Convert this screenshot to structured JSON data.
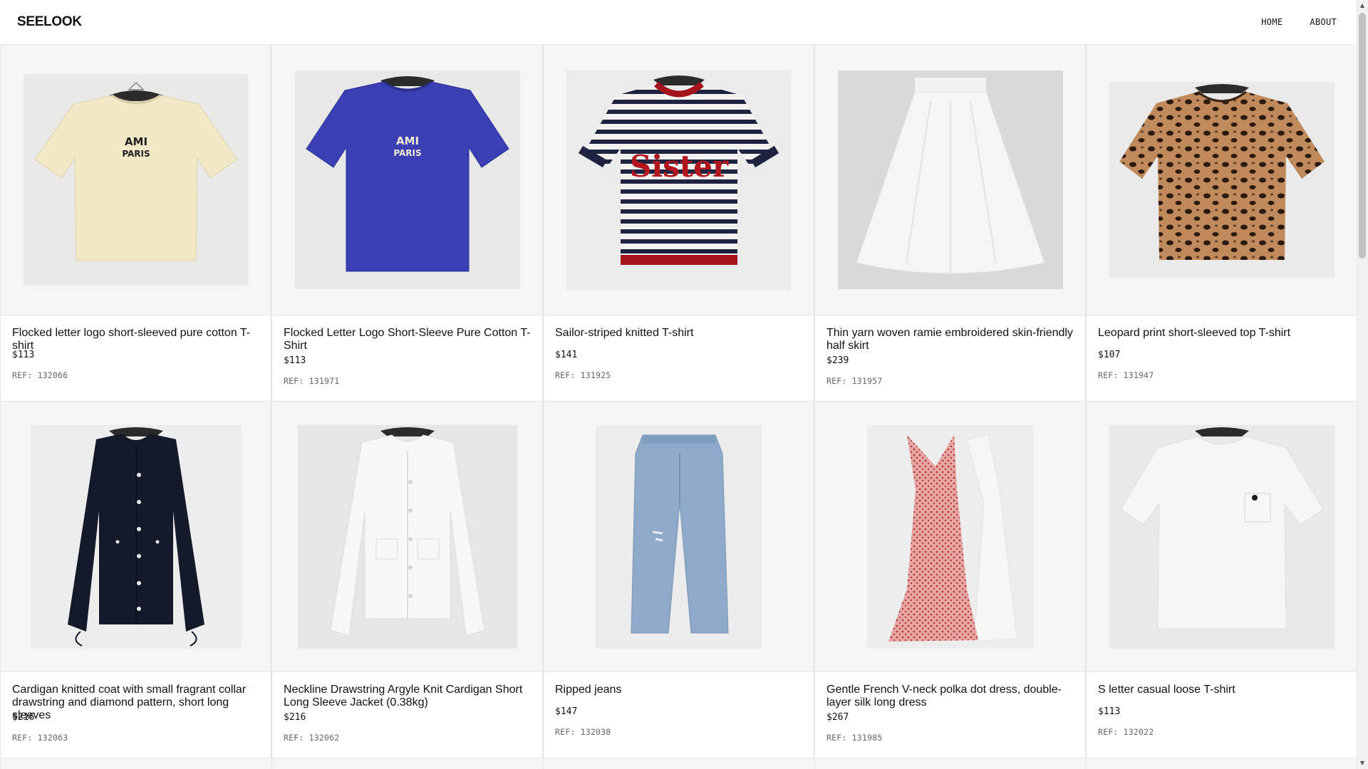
{
  "header": {
    "brand": "SEELOOK",
    "nav": [
      "HOME",
      "ABOUT"
    ]
  },
  "products": [
    {
      "name": "Flocked letter logo short-sleeved pure cotton T-shirt",
      "price": "$113",
      "ref": "REF: 132066",
      "image": "cream-tshirt-ami-paris"
    },
    {
      "name": "Flocked Letter Logo Short-Sleeve Pure Cotton T-Shirt",
      "price": "$113",
      "ref": "REF: 131971",
      "image": "blue-tshirt-ami-paris"
    },
    {
      "name": "Sailor-striped knitted T-shirt",
      "price": "$141",
      "ref": "REF: 131925",
      "image": "striped-knit-tshirt-sister"
    },
    {
      "name": "Thin yarn woven ramie embroidered skin-friendly half skirt",
      "price": "$239",
      "ref": "REF: 131957",
      "image": "white-half-skirt"
    },
    {
      "name": "Leopard print short-sleeved top T-shirt",
      "price": "$107",
      "ref": "REF: 131947",
      "image": "leopard-tshirt"
    },
    {
      "name": "Cardigan knitted coat with small fragrant collar drawstring and diamond pattern, short long sleeves",
      "price": "$216",
      "ref": "REF: 132063",
      "image": "navy-cardigan"
    },
    {
      "name": "Neckline Drawstring Argyle Knit Cardigan Short Long Sleeve Jacket (0.38kg)",
      "price": "$216",
      "ref": "REF: 132062",
      "image": "white-cardigan"
    },
    {
      "name": "Ripped jeans",
      "price": "$147",
      "ref": "REF: 132038",
      "image": "ripped-jeans"
    },
    {
      "name": "Gentle French V-neck polka dot dress, double-layer silk long dress",
      "price": "$267",
      "ref": "REF: 131985",
      "image": "polka-dot-dress"
    },
    {
      "name": "S letter casual loose T-shirt",
      "price": "$113",
      "ref": "REF: 132022",
      "image": "white-loose-tshirt"
    }
  ],
  "print_text": {
    "ami_line1": "AMI",
    "ami_line2": "PARIS",
    "sister": "Sister"
  },
  "colors": {
    "border": "#e5e5e5",
    "image_bg": "#f5f5f5",
    "ref_text": "#666666"
  }
}
